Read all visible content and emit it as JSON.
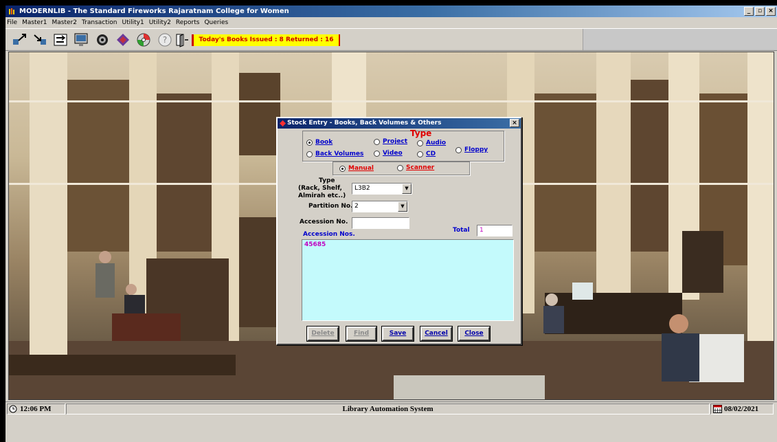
{
  "window": {
    "title": "MODERNLIB - The Standard Fireworks Rajaratnam College for Women",
    "buttons": {
      "minimize": "_",
      "maximize": "▫",
      "close": "×"
    }
  },
  "menu": [
    "File",
    "Master1",
    "Master2",
    "Transaction",
    "Utility1",
    "Utility2",
    "Reports",
    "Queries"
  ],
  "toolbar": {
    "icons": [
      "issue-book-icon",
      "return-book-icon",
      "transfer-icon",
      "catalog-icon",
      "view-icon",
      "book-icon",
      "cd-icon",
      "help-icon",
      "exit-icon"
    ],
    "status_text": "Today's Books Issued : 8 Returned : 16"
  },
  "dialog": {
    "title": "Stock Entry - Books, Back Volumes & Others",
    "close": "×",
    "type_heading": "Type",
    "type_options": [
      "Book",
      "Project",
      "Audio",
      "Back Volumes",
      "Video",
      "CD",
      "Floppy"
    ],
    "type_selected": "Book",
    "mode_options": [
      "Manual",
      "Scanner"
    ],
    "mode_selected": "Manual",
    "location_label_1": "Type",
    "location_label_2": "(Rack, Shelf,",
    "location_label_3": "Almirah etc..)",
    "location_value": "L3B2",
    "partition_label": "Partition No.",
    "partition_value": "2",
    "accession_label": "Accession No.",
    "accession_value": "",
    "accession_list_label": "Accession Nos.",
    "accession_list": [
      "45685"
    ],
    "total_label": "Total",
    "total_value": "1",
    "buttons": {
      "delete": "Delete",
      "find": "Find",
      "save": "Save",
      "cancel": "Cancel",
      "close": "Close"
    }
  },
  "statusbar": {
    "time": "12:06 PM",
    "system": "Library Automation System",
    "date": "08/02/2021"
  },
  "colors": {
    "titlebar": "#0a246a",
    "accession_bg": "#c4fafc",
    "issued_bg": "#ffff00",
    "issued_fg": "#cc0000"
  }
}
